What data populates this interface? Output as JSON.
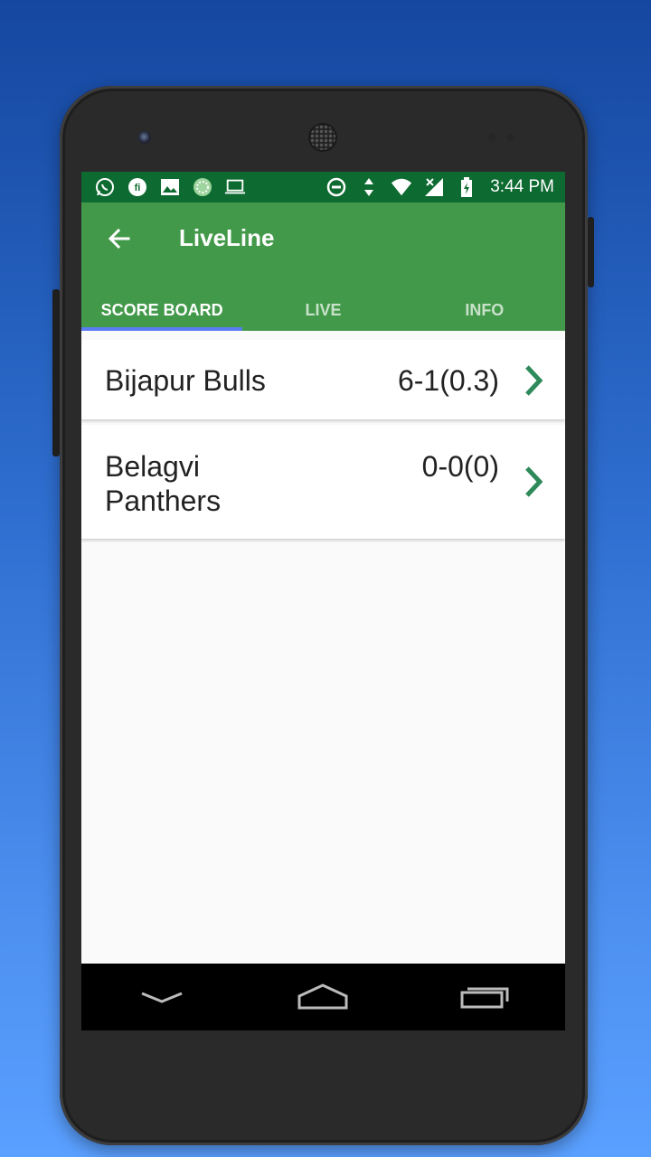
{
  "status_bar": {
    "time": "3:44 PM",
    "left_icons": [
      "whatsapp-icon",
      "fi-icon",
      "image-icon",
      "circle-icon",
      "laptop-icon"
    ],
    "right_icons": [
      "dnd-icon",
      "data-arrows-icon",
      "wifi-icon",
      "signal-icon",
      "battery-icon"
    ]
  },
  "app_bar": {
    "title": "LiveLine",
    "back_icon": "arrow-left-icon"
  },
  "tabs": [
    {
      "label": "SCORE BOARD",
      "active": true
    },
    {
      "label": "LIVE",
      "active": false
    },
    {
      "label": "INFO",
      "active": false
    }
  ],
  "scores": [
    {
      "team": "Bijapur Bulls",
      "score": "6-1(0.3)"
    },
    {
      "team": "Belagvi Panthers",
      "score": "0-0(0)"
    }
  ],
  "colors": {
    "status_bar": "#0d6a30",
    "app_bar": "#43994a",
    "tab_indicator": "#5a7cf5",
    "chevron": "#2e8a5a"
  },
  "nav_bar": {
    "icons": [
      "back-chevron-icon",
      "home-icon",
      "recents-icon"
    ]
  }
}
